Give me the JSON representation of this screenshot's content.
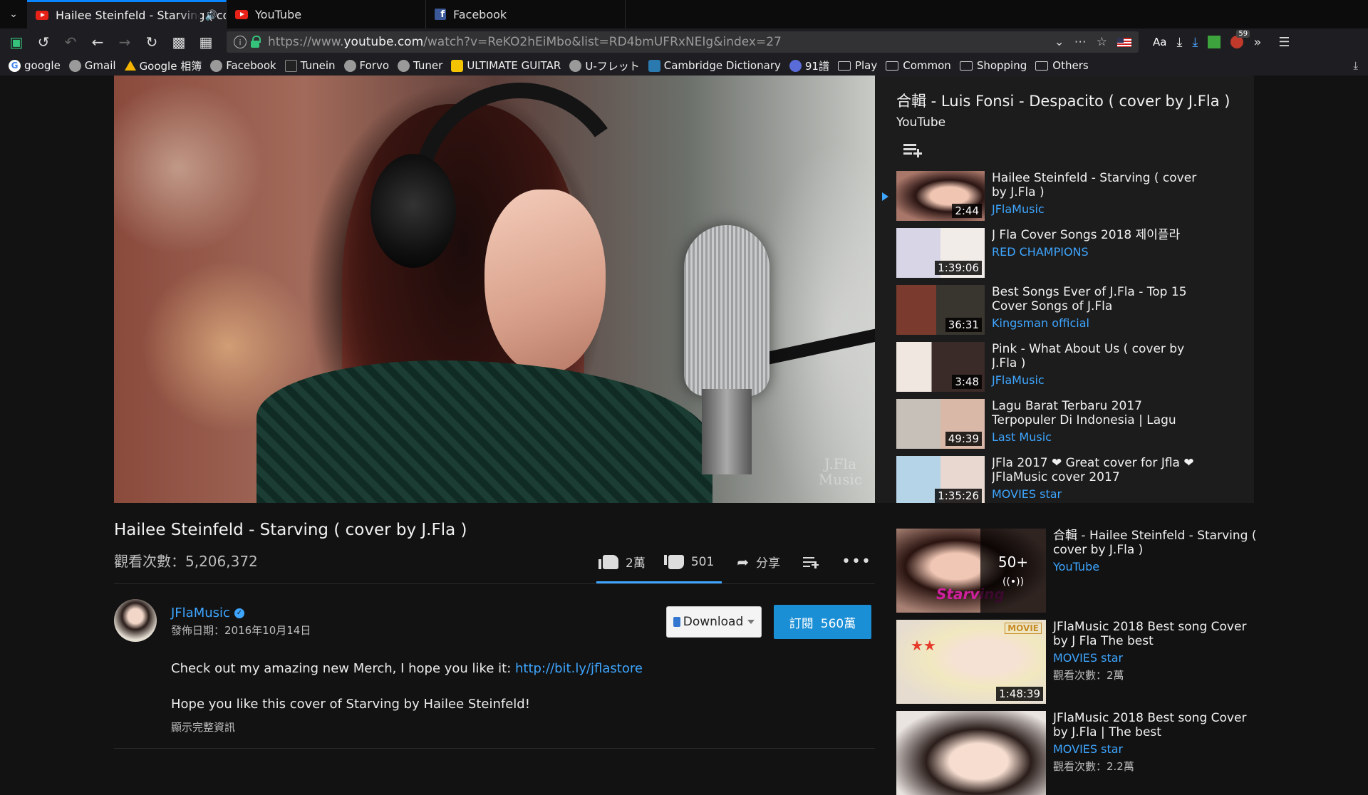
{
  "browser": {
    "tabs": [
      {
        "title": "Hailee Steinfeld - Starving ( co",
        "icon": "youtube-icon",
        "active": true,
        "audio": true
      },
      {
        "title": "YouTube",
        "icon": "youtube-icon",
        "active": false
      },
      {
        "title": "Facebook",
        "icon": "facebook-icon",
        "active": false
      }
    ],
    "url": {
      "prefix": "https://www.",
      "host": "youtube.com",
      "path": "/watch?v=ReKO2hEiMbo&list=RD4bmUFRxNEIg&index=27"
    },
    "reader_label": "Aa",
    "notification_count": "59",
    "bookmarks": [
      {
        "label": "google",
        "icon": "google-icon"
      },
      {
        "label": "Gmail",
        "icon": "globe-icon"
      },
      {
        "label": "Google 相簿",
        "icon": "drive-icon"
      },
      {
        "label": "Facebook",
        "icon": "globe-icon"
      },
      {
        "label": "Tunein",
        "icon": "tunein-icon"
      },
      {
        "label": "Forvo",
        "icon": "globe-icon"
      },
      {
        "label": "Tuner",
        "icon": "globe-icon"
      },
      {
        "label": "ULTIMATE GUITAR",
        "icon": "ultimate-guitar-icon"
      },
      {
        "label": "U-フレット",
        "icon": "globe-icon"
      },
      {
        "label": "Cambridge Dictionary",
        "icon": "cambridge-icon"
      },
      {
        "label": "91譜",
        "icon": "num-icon"
      },
      {
        "label": "Play",
        "icon": "folder-icon"
      },
      {
        "label": "Common",
        "icon": "folder-icon"
      },
      {
        "label": "Shopping",
        "icon": "folder-icon"
      },
      {
        "label": "Others",
        "icon": "folder-icon"
      }
    ]
  },
  "player": {
    "watermark_line1": "J.Fla",
    "watermark_line2": "Music"
  },
  "playlist": {
    "title": "合輯 - Luis Fonsi - Despacito ( cover by J.Fla )",
    "owner": "YouTube",
    "items": [
      {
        "title": "Hailee Steinfeld - Starving ( cover by J.Fla )",
        "channel": "JFlaMusic",
        "duration": "2:44",
        "now_playing": true
      },
      {
        "title": "J Fla Cover Songs 2018 제이플라",
        "channel": "RED CHAMPIONS",
        "duration": "1:39:06"
      },
      {
        "title": "Best Songs Ever of J.Fla - Top 15 Cover Songs of J.Fla",
        "channel": "Kingsman official",
        "duration": "36:31"
      },
      {
        "title": "Pink - What About Us ( cover by J.Fla )",
        "channel": "JFlaMusic",
        "duration": "3:48"
      },
      {
        "title": "Lagu Barat Terbaru 2017 Terpopuler Di Indonesia | Lagu",
        "channel": "Last Music",
        "duration": "49:39"
      },
      {
        "title": "JFla 2017 ❤ Great cover for Jfla ❤ JFlaMusic cover 2017",
        "channel": "MOVIES star",
        "duration": "1:35:26"
      }
    ]
  },
  "video": {
    "title": "Hailee Steinfeld - Starving ( cover by J.Fla )",
    "views": "觀看次數：5,206,372",
    "likes": "2萬",
    "dislikes": "501",
    "share_label": "分享",
    "channel": "JFlaMusic",
    "published": "發佈日期：2016年10月14日",
    "download_label": "Download",
    "subscribe_label": "訂閱",
    "subscriber_count": "560萬",
    "description_line1": "Check out my amazing new Merch, I hope you like it: ",
    "description_link": "http://bit.ly/jflastore",
    "description_line2": "Hope you like this cover of Starving by Hailee Steinfeld!",
    "show_more": "顯示完整資訊"
  },
  "recommendations": [
    {
      "title": "合輯 - Hailee Steinfeld - Starving ( cover by J.Fla )",
      "channel": "YouTube",
      "mix_count": "50+",
      "overlay_text": "Starving"
    },
    {
      "title": "JFlaMusic 2018 Best song Cover by J Fla The best",
      "channel": "MOVIES star",
      "views": "觀看次數：2萬",
      "duration": "1:48:39",
      "badge": "MOVIE"
    },
    {
      "title": "JFlaMusic 2018 Best song Cover by J.Fla | The best",
      "channel": "MOVIES star",
      "views": "觀看次數：2.2萬"
    }
  ],
  "colors": {
    "accent_blue": "#3ea6ff",
    "subscribe_blue": "#1a8fd6",
    "tab_highlight": "#0a84ff",
    "youtube_red": "#e62117"
  }
}
